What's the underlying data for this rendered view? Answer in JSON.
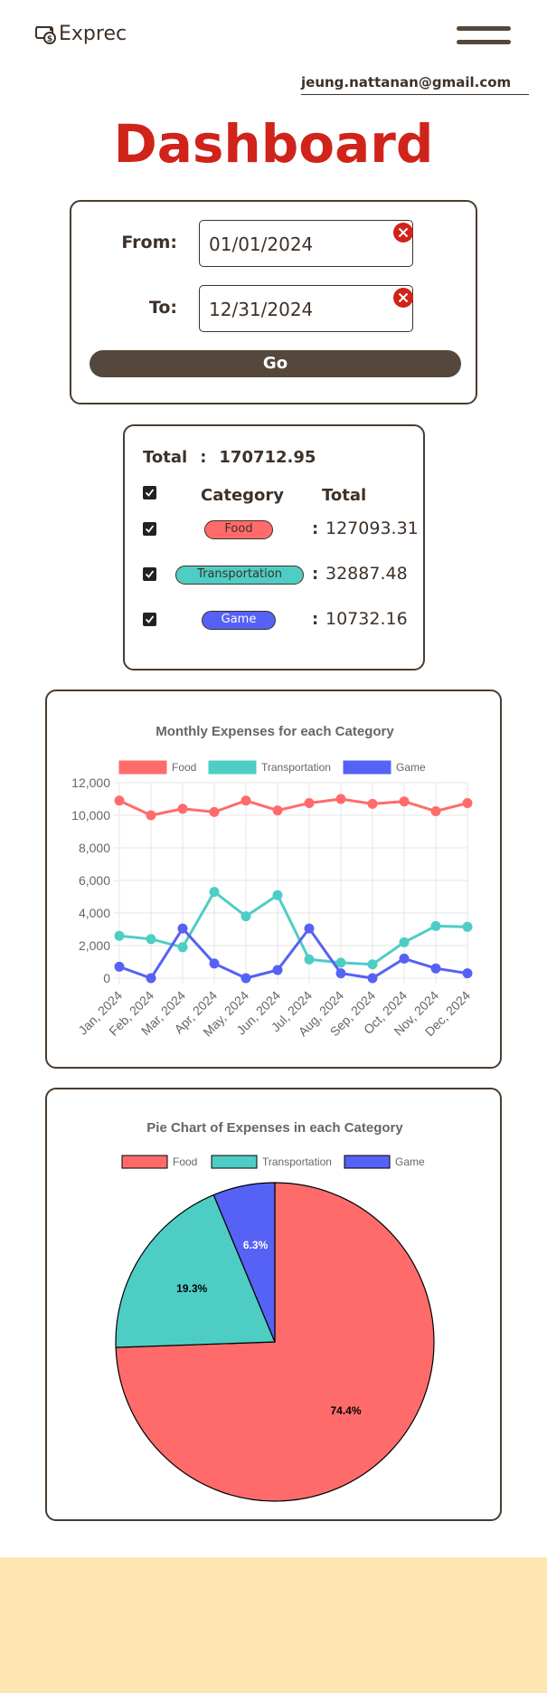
{
  "app": {
    "name": "Exprec",
    "logo_icon": "wallet-dollar-icon",
    "menu_icon": "hamburger-menu-icon"
  },
  "user": {
    "email": "jeung.nattanan@gmail.com"
  },
  "page": {
    "title": "Dashboard"
  },
  "date_filter": {
    "from_label": "From:",
    "from_value": "01/01/2024",
    "to_label": "To:",
    "to_value": "12/31/2024",
    "go_label": "Go"
  },
  "summary": {
    "total_label": "Total",
    "colon": ":",
    "total_value": "170712.95",
    "headers": {
      "category": "Category",
      "total": "Total"
    },
    "rows": [
      {
        "category": "Food",
        "value": "127093.31",
        "checked": true,
        "color": "#ff6b6b",
        "text_color": "#3e3128"
      },
      {
        "category": "Transportation",
        "value": "32887.48",
        "checked": true,
        "color": "#4ecdc4",
        "text_color": "#3e3128"
      },
      {
        "category": "Game",
        "value": "10732.16",
        "checked": true,
        "color": "#5661f5",
        "text_color": "#ffffff"
      }
    ]
  },
  "colors": {
    "accent_red": "#d0231a",
    "brown": "#55473b",
    "footer": "#fee6b2"
  },
  "chart_data": [
    {
      "type": "line",
      "title": "Monthly Expenses for each Category",
      "x": [
        "Jan, 2024",
        "Feb, 2024",
        "Mar, 2024",
        "Apr, 2024",
        "May, 2024",
        "Jun, 2024",
        "Jul, 2024",
        "Aug, 2024",
        "Sep, 2024",
        "Oct, 2024",
        "Nov, 2024",
        "Dec, 2024"
      ],
      "ylim": [
        0,
        12000
      ],
      "yticks": [
        0,
        2000,
        4000,
        6000,
        8000,
        10000,
        12000
      ],
      "ytick_labels": [
        "0",
        "2,000",
        "4,000",
        "6,000",
        "8,000",
        "10,000",
        "12,000"
      ],
      "grid": true,
      "legend": "top",
      "series": [
        {
          "name": "Food",
          "color": "#ff6b6b",
          "values": [
            10900,
            10000,
            10400,
            10200,
            10900,
            10300,
            10750,
            11000,
            10700,
            10850,
            10250,
            10750
          ]
        },
        {
          "name": "Transportation",
          "color": "#4ecdc4",
          "values": [
            2600,
            2400,
            1900,
            5300,
            3800,
            5100,
            1150,
            950,
            850,
            2200,
            3200,
            3150
          ]
        },
        {
          "name": "Game",
          "color": "#5661f5",
          "values": [
            700,
            0,
            3050,
            900,
            0,
            500,
            3050,
            300,
            0,
            1200,
            600,
            300
          ]
        }
      ]
    },
    {
      "type": "pie",
      "title": "Pie Chart of Expenses in each Category",
      "legend": "top",
      "labels": [
        "Food",
        "Transportation",
        "Game"
      ],
      "values": [
        127093.31,
        32887.48,
        10732.16
      ],
      "percent_labels": [
        "74.4%",
        "19.3%",
        "6.3%"
      ],
      "colors": [
        "#ff6b6b",
        "#4ecdc4",
        "#5661f5"
      ]
    }
  ]
}
